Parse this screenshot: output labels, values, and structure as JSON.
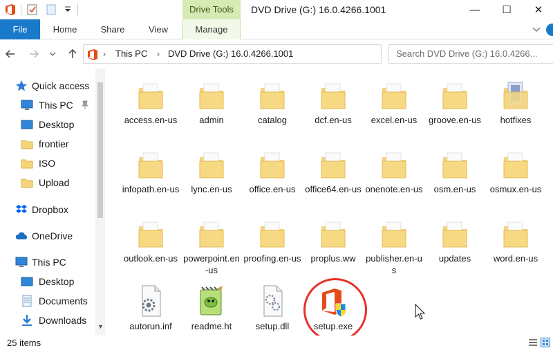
{
  "window": {
    "context_tab_group": "Drive Tools",
    "title": "DVD Drive (G:) 16.0.4266.1001",
    "minimize": "—",
    "maximize": "☐",
    "close": "✕"
  },
  "ribbon": {
    "tabs": [
      "File",
      "Home",
      "Share",
      "View",
      "Manage"
    ],
    "active_tab": "Manage"
  },
  "address": {
    "crumbs": [
      "This PC",
      "DVD Drive (G:) 16.0.4266.1001"
    ],
    "search_placeholder": "Search DVD Drive (G:) 16.0.4266..."
  },
  "sidebar": {
    "items": [
      {
        "label": "Quick access",
        "icon": "star-icon"
      },
      {
        "label": "This PC",
        "icon": "monitor-icon",
        "pinned": true
      },
      {
        "label": "Desktop",
        "icon": "desktop-icon"
      },
      {
        "label": "frontier",
        "icon": "folder-icon"
      },
      {
        "label": "ISO",
        "icon": "folder-icon"
      },
      {
        "label": "Upload",
        "icon": "folder-icon"
      },
      {
        "label": "Dropbox",
        "icon": "dropbox-icon"
      },
      {
        "label": "OneDrive",
        "icon": "cloud-icon"
      },
      {
        "label": "This PC",
        "icon": "monitor-icon"
      },
      {
        "label": "Desktop",
        "icon": "desktop-icon"
      },
      {
        "label": "Documents",
        "icon": "documents-icon"
      },
      {
        "label": "Downloads",
        "icon": "downloads-icon"
      }
    ]
  },
  "files": [
    {
      "name": "access.en-us",
      "type": "folder"
    },
    {
      "name": "admin",
      "type": "folder"
    },
    {
      "name": "catalog",
      "type": "folder"
    },
    {
      "name": "dcf.en-us",
      "type": "folder"
    },
    {
      "name": "excel.en-us",
      "type": "folder"
    },
    {
      "name": "groove.en-us",
      "type": "folder"
    },
    {
      "name": "hotfixes",
      "type": "folder"
    },
    {
      "name": "infopath.en-us",
      "type": "folder"
    },
    {
      "name": "lync.en-us",
      "type": "folder"
    },
    {
      "name": "office.en-us",
      "type": "folder"
    },
    {
      "name": "office64.en-us",
      "type": "folder"
    },
    {
      "name": "onenote.en-us",
      "type": "folder"
    },
    {
      "name": "osm.en-us",
      "type": "folder"
    },
    {
      "name": "osmux.en-us",
      "type": "folder"
    },
    {
      "name": "outlook.en-us",
      "type": "folder"
    },
    {
      "name": "powerpoint.en-us",
      "type": "folder"
    },
    {
      "name": "proofing.en-us",
      "type": "folder"
    },
    {
      "name": "proplus.ww",
      "type": "folder"
    },
    {
      "name": "publisher.en-us",
      "type": "folder"
    },
    {
      "name": "updates",
      "type": "folder"
    },
    {
      "name": "word.en-us",
      "type": "folder"
    },
    {
      "name": "autorun.inf",
      "type": "config"
    },
    {
      "name": "readme.ht",
      "type": "html"
    },
    {
      "name": "setup.dll",
      "type": "dll"
    },
    {
      "name": "setup.exe",
      "type": "setup"
    }
  ],
  "status": {
    "item_count": "25 items"
  },
  "colors": {
    "accent": "#1979ca",
    "context_tab": "#d7e9b4",
    "folder": "#f5d47a",
    "highlight_ring": "#e8302a"
  }
}
